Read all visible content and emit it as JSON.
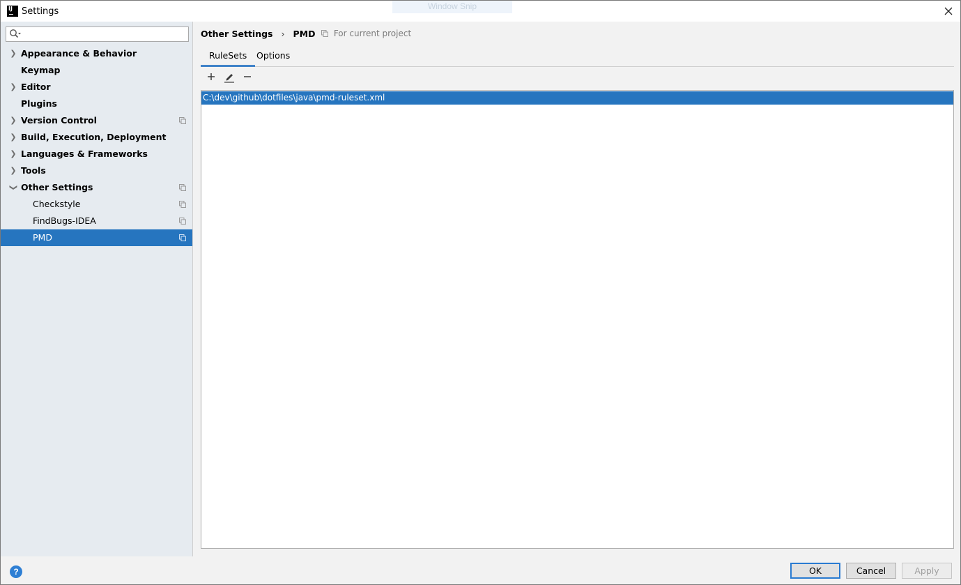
{
  "window": {
    "title": "Settings",
    "app_icon_text": "IJ",
    "overlay_text": "Window Snip"
  },
  "search": {
    "value": "",
    "placeholder": ""
  },
  "sidebar": {
    "items": [
      {
        "label": "Appearance & Behavior",
        "bold": true,
        "expandable": true,
        "expanded": false,
        "project_icon": false
      },
      {
        "label": "Keymap",
        "bold": true,
        "expandable": false,
        "project_icon": false
      },
      {
        "label": "Editor",
        "bold": true,
        "expandable": true,
        "expanded": false,
        "project_icon": false
      },
      {
        "label": "Plugins",
        "bold": true,
        "expandable": false,
        "project_icon": false
      },
      {
        "label": "Version Control",
        "bold": true,
        "expandable": true,
        "expanded": false,
        "project_icon": true
      },
      {
        "label": "Build, Execution, Deployment",
        "bold": true,
        "expandable": true,
        "expanded": false,
        "project_icon": false
      },
      {
        "label": "Languages & Frameworks",
        "bold": true,
        "expandable": true,
        "expanded": false,
        "project_icon": false
      },
      {
        "label": "Tools",
        "bold": true,
        "expandable": true,
        "expanded": false,
        "project_icon": false
      },
      {
        "label": "Other Settings",
        "bold": true,
        "expandable": true,
        "expanded": true,
        "project_icon": true
      },
      {
        "label": "Checkstyle",
        "bold": false,
        "child": true,
        "project_icon": true
      },
      {
        "label": "FindBugs-IDEA",
        "bold": false,
        "child": true,
        "project_icon": true
      },
      {
        "label": "PMD",
        "bold": false,
        "child": true,
        "project_icon": true,
        "selected": true
      }
    ]
  },
  "breadcrumb": {
    "parent": "Other Settings",
    "separator": "›",
    "current": "PMD",
    "scope_note": "For current project"
  },
  "tabs": [
    {
      "label": "RuleSets",
      "active": true
    },
    {
      "label": "Options",
      "active": false
    }
  ],
  "toolbar": {
    "add_icon": "plus-icon",
    "edit_icon": "pencil-icon",
    "remove_icon": "minus-icon"
  },
  "rulesets": [
    "C:\\dev\\github\\dotfiles\\java\\pmd-ruleset.xml"
  ],
  "footer": {
    "help_label": "?",
    "ok_label": "OK",
    "cancel_label": "Cancel",
    "apply_label": "Apply"
  },
  "colors": {
    "selection": "#2675bf",
    "sidebar_bg": "#e6ebf0",
    "tab_underline": "#4083c9",
    "help_blue": "#2e7fd4"
  }
}
